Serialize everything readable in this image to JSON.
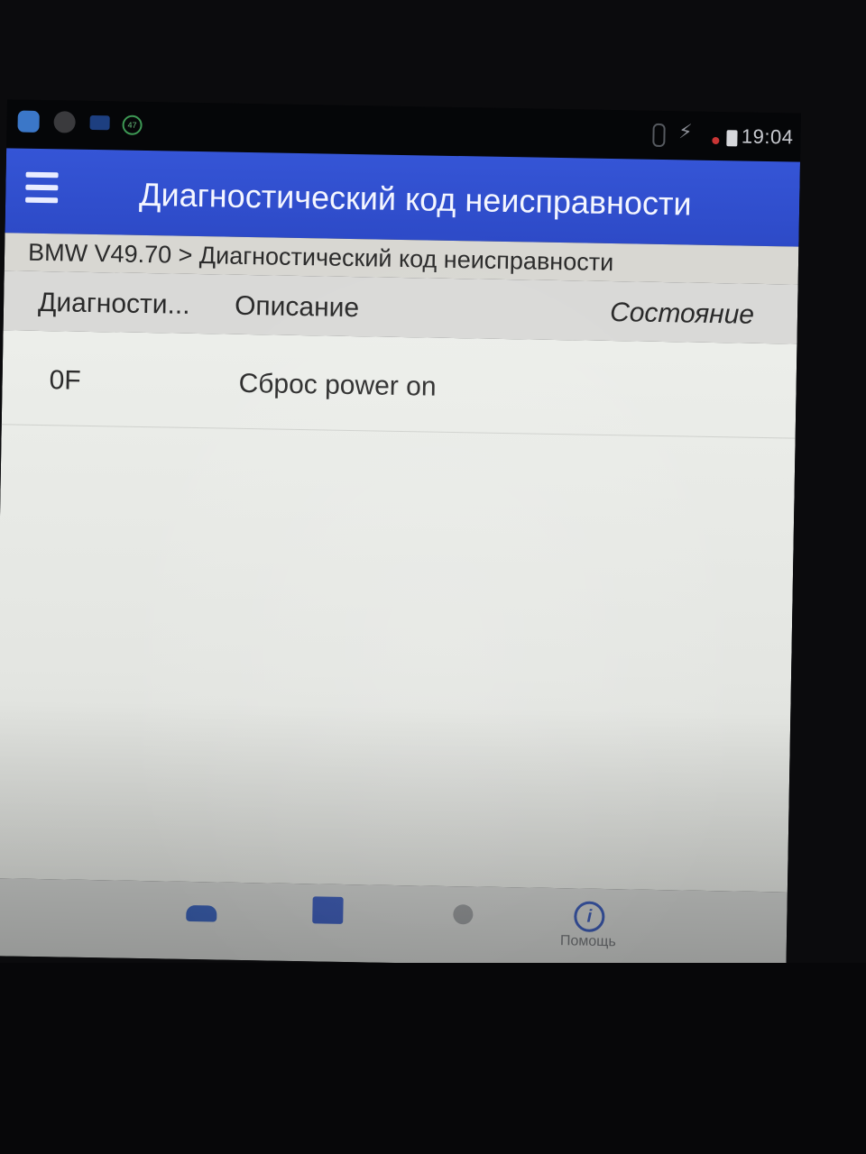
{
  "status_bar": {
    "time": "19:04",
    "badge": "47",
    "icons": [
      "app-icon",
      "face-icon",
      "mail-icon",
      "badge-47-icon",
      "bluetooth-icon",
      "mute-icon",
      "record-icon",
      "battery-icon"
    ]
  },
  "app_bar": {
    "title": "Диагностический код неисправности",
    "menu_icon": "hamburger-menu-icon"
  },
  "breadcrumb": "BMW V49.70 > Диагностический код неисправности",
  "table": {
    "headers": {
      "code": "Диагности...",
      "description": "Описание",
      "state": "Состояние"
    },
    "rows": [
      {
        "code": "0F",
        "description": "Сброс power on",
        "state": ""
      }
    ]
  },
  "bottom_nav": {
    "items": [
      {
        "icon": "car-icon",
        "label": ""
      },
      {
        "icon": "report-icon",
        "label": ""
      },
      {
        "icon": "gear-icon",
        "label": ""
      },
      {
        "icon": "info-icon",
        "label": "Помощь"
      }
    ]
  },
  "colors": {
    "app_bar": "#3050d0",
    "breadcrumb_bg": "#d8d7d2",
    "table_bg": "#eceeea"
  }
}
